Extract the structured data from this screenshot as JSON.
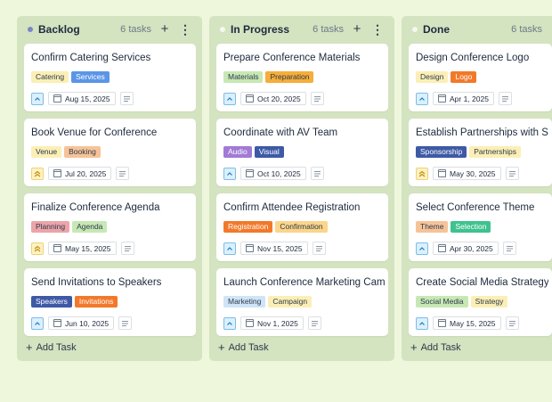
{
  "columns": [
    {
      "title": "Backlog",
      "count": "6 tasks",
      "dot_color": "#7b86c4",
      "add_label": "Add Task",
      "cards": [
        {
          "title": "Confirm Catering Services",
          "tags": [
            {
              "label": "Catering",
              "bg": "#fbefb6",
              "fg": "#2c3a4a"
            },
            {
              "label": "Services",
              "bg": "#5b95e7",
              "fg": "#ffffff"
            }
          ],
          "priority": "low",
          "priority_icon": "chevron-up-icon",
          "date": "Aug 15, 2025"
        },
        {
          "title": "Book Venue for Conference",
          "tags": [
            {
              "label": "Venue",
              "bg": "#fbefb6",
              "fg": "#2c3a4a"
            },
            {
              "label": "Booking",
              "bg": "#f6c399",
              "fg": "#2c3a4a"
            }
          ],
          "priority": "medium",
          "priority_icon": "double-chevron-up-icon",
          "date": "Jul 20, 2025"
        },
        {
          "title": "Finalize Conference Agenda",
          "tags": [
            {
              "label": "Planning",
              "bg": "#eca4a9",
              "fg": "#2c3a4a"
            },
            {
              "label": "Agenda",
              "bg": "#c7e8b4",
              "fg": "#2c3a4a"
            }
          ],
          "priority": "medium",
          "priority_icon": "double-chevron-up-icon",
          "date": "May 15, 2025"
        },
        {
          "title": "Send Invitations to Speakers",
          "tags": [
            {
              "label": "Speakers",
              "bg": "#3e5aa6",
              "fg": "#ffffff"
            },
            {
              "label": "Invitations",
              "bg": "#f2792a",
              "fg": "#ffffff"
            }
          ],
          "priority": "low",
          "priority_icon": "chevron-up-icon",
          "date": "Jun 10, 2025"
        }
      ]
    },
    {
      "title": "In Progress",
      "count": "6 tasks",
      "dot_color": "#f4f8ee",
      "add_label": "Add Task",
      "cards": [
        {
          "title": "Prepare Conference Materials",
          "tags": [
            {
              "label": "Materials",
              "bg": "#c7e8b4",
              "fg": "#2c3a4a"
            },
            {
              "label": "Preparation",
              "bg": "#f6ad3a",
              "fg": "#2c3a4a"
            }
          ],
          "priority": "low",
          "priority_icon": "chevron-up-icon",
          "date": "Oct 20, 2025"
        },
        {
          "title": "Coordinate with AV Team",
          "tags": [
            {
              "label": "Audio",
              "bg": "#a27ad6",
              "fg": "#ffffff"
            },
            {
              "label": "Visual",
              "bg": "#3e5aa6",
              "fg": "#ffffff"
            }
          ],
          "priority": "low",
          "priority_icon": "chevron-up-icon",
          "date": "Oct 10, 2025"
        },
        {
          "title": "Confirm Attendee Registration",
          "tags": [
            {
              "label": "Registration",
              "bg": "#f2792a",
              "fg": "#ffffff"
            },
            {
              "label": "Confirmation",
              "bg": "#fbd58a",
              "fg": "#2c3a4a"
            }
          ],
          "priority": "low",
          "priority_icon": "chevron-up-icon",
          "date": "Nov 15, 2025"
        },
        {
          "title": "Launch Conference Marketing Campaign",
          "tags": [
            {
              "label": "Marketing",
              "bg": "#cfe4f7",
              "fg": "#2c3a4a"
            },
            {
              "label": "Campaign",
              "bg": "#fbefb6",
              "fg": "#2c3a4a"
            }
          ],
          "priority": "low",
          "priority_icon": "chevron-up-icon",
          "date": "Nov 1, 2025"
        }
      ]
    },
    {
      "title": "Done",
      "count": "6 tasks",
      "dot_color": "#f4f8ee",
      "add_label": "Add Task",
      "cards": [
        {
          "title": "Design Conference Logo",
          "tags": [
            {
              "label": "Design",
              "bg": "#fbefb6",
              "fg": "#2c3a4a"
            },
            {
              "label": "Logo",
              "bg": "#f2792a",
              "fg": "#ffffff"
            }
          ],
          "priority": "low",
          "priority_icon": "chevron-up-icon",
          "date": "Apr 1, 2025"
        },
        {
          "title": "Establish Partnerships with Sponsors",
          "tags": [
            {
              "label": "Sponsorship",
              "bg": "#3e5aa6",
              "fg": "#ffffff"
            },
            {
              "label": "Partnerships",
              "bg": "#fbefb6",
              "fg": "#2c3a4a"
            }
          ],
          "priority": "medium",
          "priority_icon": "double-chevron-up-icon",
          "date": "May 30, 2025"
        },
        {
          "title": "Select Conference Theme",
          "tags": [
            {
              "label": "Theme",
              "bg": "#f6c399",
              "fg": "#2c3a4a"
            },
            {
              "label": "Selection",
              "bg": "#3fc28f",
              "fg": "#ffffff"
            }
          ],
          "priority": "low",
          "priority_icon": "chevron-up-icon",
          "date": "Apr 30, 2025"
        },
        {
          "title": "Create Social Media Strategy",
          "tags": [
            {
              "label": "Social Media",
              "bg": "#c7e8b4",
              "fg": "#2c3a4a"
            },
            {
              "label": "Strategy",
              "bg": "#fbefb6",
              "fg": "#2c3a4a"
            }
          ],
          "priority": "low",
          "priority_icon": "chevron-up-icon",
          "date": "May 15, 2025"
        }
      ]
    }
  ]
}
